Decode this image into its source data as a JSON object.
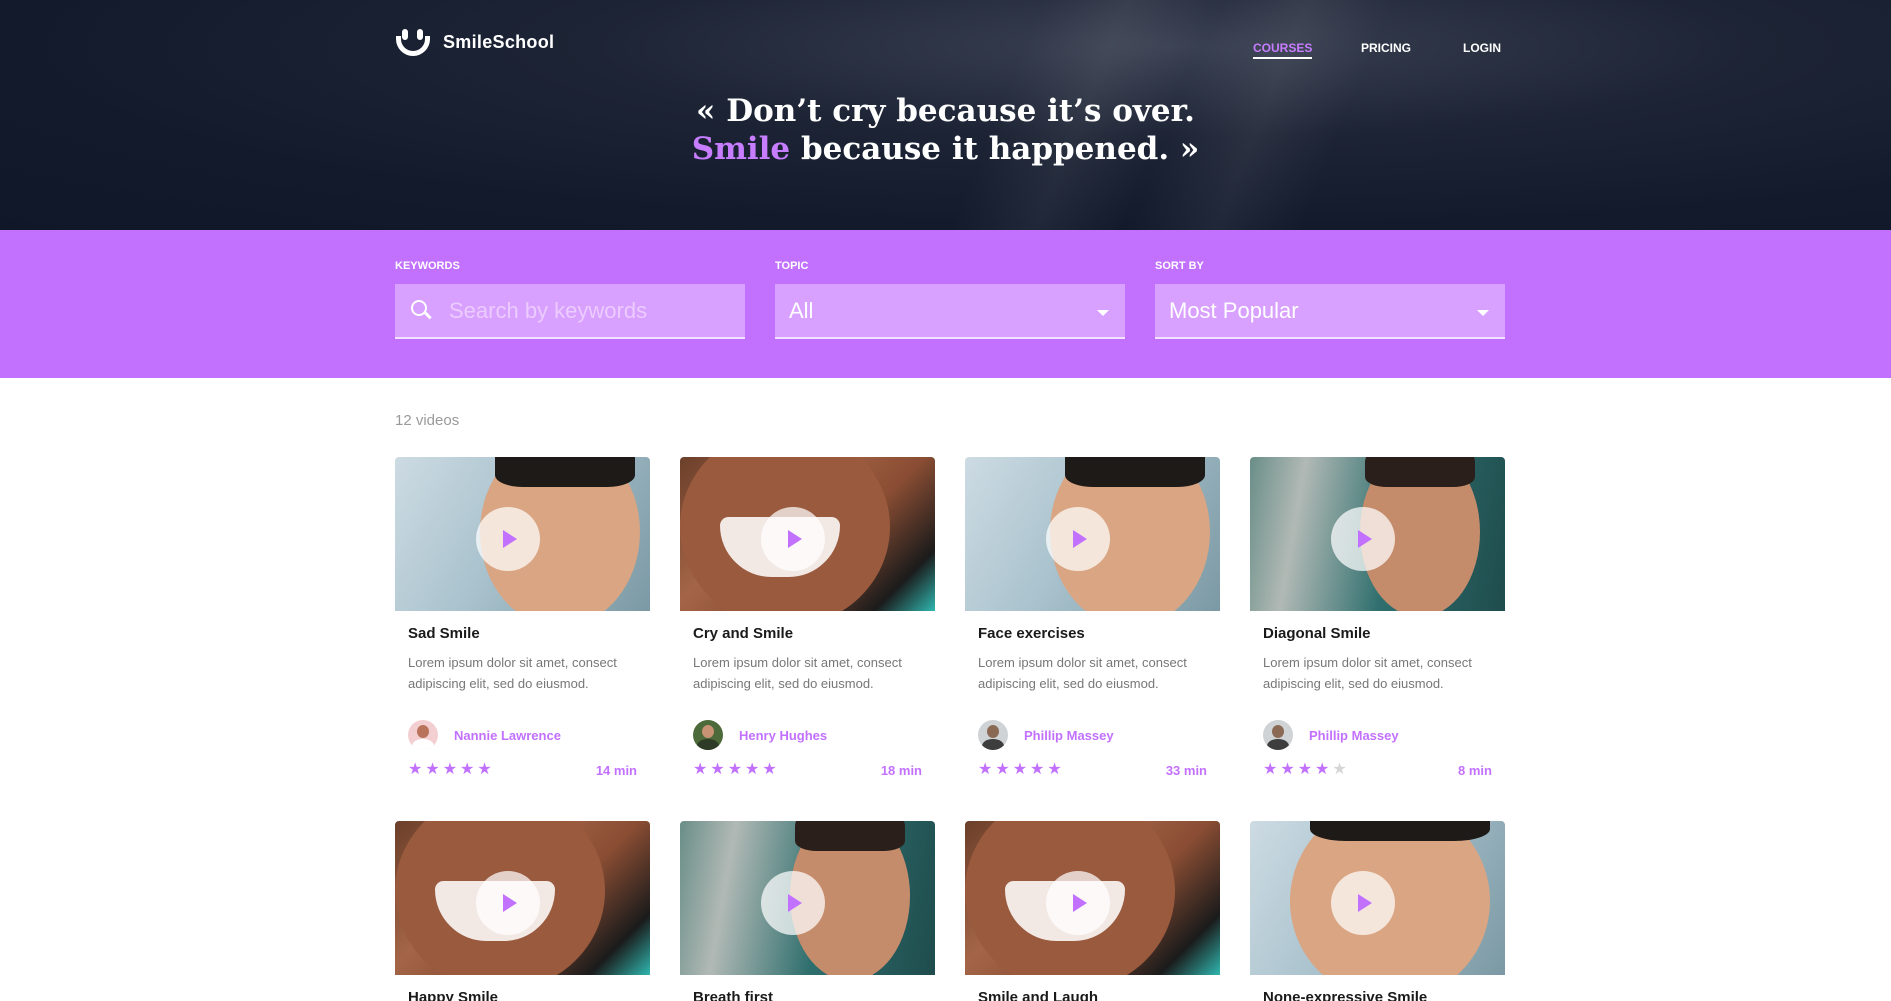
{
  "brand": {
    "name": "SmileSchool"
  },
  "nav": {
    "items": [
      {
        "label": "COURSES",
        "active": true
      },
      {
        "label": "PRICING",
        "active": false
      },
      {
        "label": "LOGIN",
        "active": false
      }
    ]
  },
  "hero": {
    "quote_line1": "« Don’t cry because it’s over.",
    "quote_accent": "Smile",
    "quote_line2_rest": " because it happened. »"
  },
  "filters": {
    "keywords": {
      "label": "KEYWORDS",
      "placeholder": "Search by keywords",
      "value": ""
    },
    "topic": {
      "label": "TOPIC",
      "value": "All"
    },
    "sort": {
      "label": "SORT BY",
      "value": "Most Popular"
    }
  },
  "results": {
    "count_text": "12 videos"
  },
  "colors": {
    "accent": "#c271ff",
    "hero_bg": "#121a2c",
    "star_off": "#d6d6d6"
  },
  "cards": [
    {
      "title": "Sad Smile",
      "desc": "Lorem ipsum dolor sit amet, consect adipiscing elit, sed do eiusmod.",
      "author": "Nannie Lawrence",
      "rating": 5,
      "duration": "14 min"
    },
    {
      "title": "Cry and Smile",
      "desc": "Lorem ipsum dolor sit amet, consect adipiscing elit, sed do eiusmod.",
      "author": "Henry Hughes",
      "rating": 5,
      "duration": "18 min"
    },
    {
      "title": "Face exercises",
      "desc": "Lorem ipsum dolor sit amet, consect adipiscing elit, sed do eiusmod.",
      "author": "Phillip Massey",
      "rating": 5,
      "duration": "33 min"
    },
    {
      "title": "Diagonal Smile",
      "desc": "Lorem ipsum dolor sit amet, consect adipiscing elit, sed do eiusmod.",
      "author": "Phillip Massey",
      "rating": 4,
      "duration": "8 min"
    },
    {
      "title": "Happy Smile"
    },
    {
      "title": "Breath first"
    },
    {
      "title": "Smile and Laugh"
    },
    {
      "title": "None-expressive Smile"
    }
  ]
}
